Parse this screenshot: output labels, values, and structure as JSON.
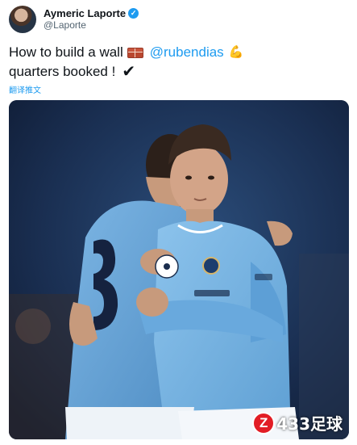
{
  "author": {
    "name": "Aymeric Laporte",
    "handle": "@Laporte"
  },
  "tweet": {
    "line1_text": "How to build a wall",
    "mention": "@rubendias",
    "line2_text": "quarters booked !"
  },
  "translate_link": "翻译推文",
  "watermark": {
    "badge": "Z",
    "text": "433足球"
  },
  "colors": {
    "link": "#1d9bf0",
    "jersey_blue": "#6cabdd",
    "watermark_red": "#e21d25"
  },
  "icons": [
    "verified-badge-icon",
    "brick-emoji-icon",
    "flexed-biceps-emoji-icon",
    "check-mark-icon"
  ]
}
